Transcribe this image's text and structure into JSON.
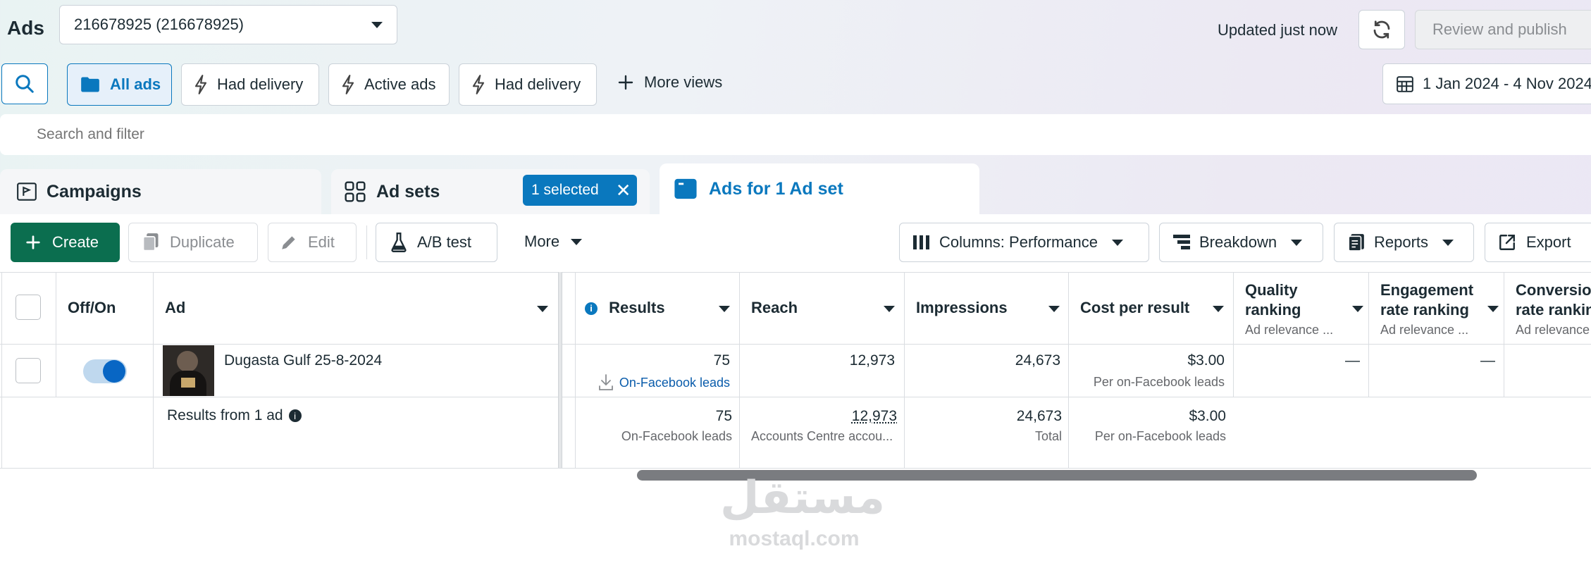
{
  "header": {
    "title": "Ads",
    "account_select": "216678925 (216678925)",
    "updated_text": "Updated just now",
    "review_publish": "Review and publish"
  },
  "views": {
    "all_ads": "All ads",
    "had_delivery_1": "Had delivery",
    "active_ads": "Active ads",
    "had_delivery_2": "Had delivery",
    "more_views": "More views",
    "date_range": "1 Jan 2024 - 4 Nov 2024"
  },
  "search": {
    "placeholder": "Search and filter"
  },
  "tabs": {
    "campaigns": "Campaigns",
    "ad_sets": "Ad sets",
    "selected_badge": "1 selected",
    "ads": "Ads for 1 Ad set"
  },
  "toolbar": {
    "create": "Create",
    "duplicate": "Duplicate",
    "edit": "Edit",
    "ab_test": "A/B test",
    "more": "More",
    "columns": "Columns: Performance",
    "breakdown": "Breakdown",
    "reports": "Reports",
    "export": "Export"
  },
  "table": {
    "headers": {
      "off_on": "Off/On",
      "ad": "Ad",
      "results": "Results",
      "reach": "Reach",
      "impressions": "Impressions",
      "cost_per_result": "Cost per result",
      "quality_ranking": "Quality ranking",
      "quality_sub": "Ad relevance ...",
      "engagement_ranking": "Engagement rate ranking",
      "engagement_sub": "Ad relevance ...",
      "conversion_ranking": "Conversion rate ranking",
      "conversion_sub": "Ad relevance"
    },
    "row": {
      "ad_name": "Dugasta Gulf 25-8-2024",
      "results": "75",
      "results_sub": "On-Facebook leads",
      "reach": "12,973",
      "impressions": "24,673",
      "cost": "$3.00",
      "cost_sub": "Per on-Facebook leads",
      "quality": "—",
      "engagement": "—",
      "toggle_on": true
    },
    "summary": {
      "label": "Results from 1 ad",
      "results": "75",
      "results_sub": "On-Facebook leads",
      "reach": "12,973",
      "reach_sub": "Accounts Centre accou...",
      "impressions": "24,673",
      "impressions_sub": "Total",
      "cost": "$3.00",
      "cost_sub": "Per on-Facebook leads"
    }
  },
  "watermark": {
    "arabic": "مستقل",
    "latin": "mostaql.com"
  },
  "colors": {
    "primary": "#0a78be",
    "create_green": "#0b6e4f",
    "accent_blue": "#0866c4"
  }
}
